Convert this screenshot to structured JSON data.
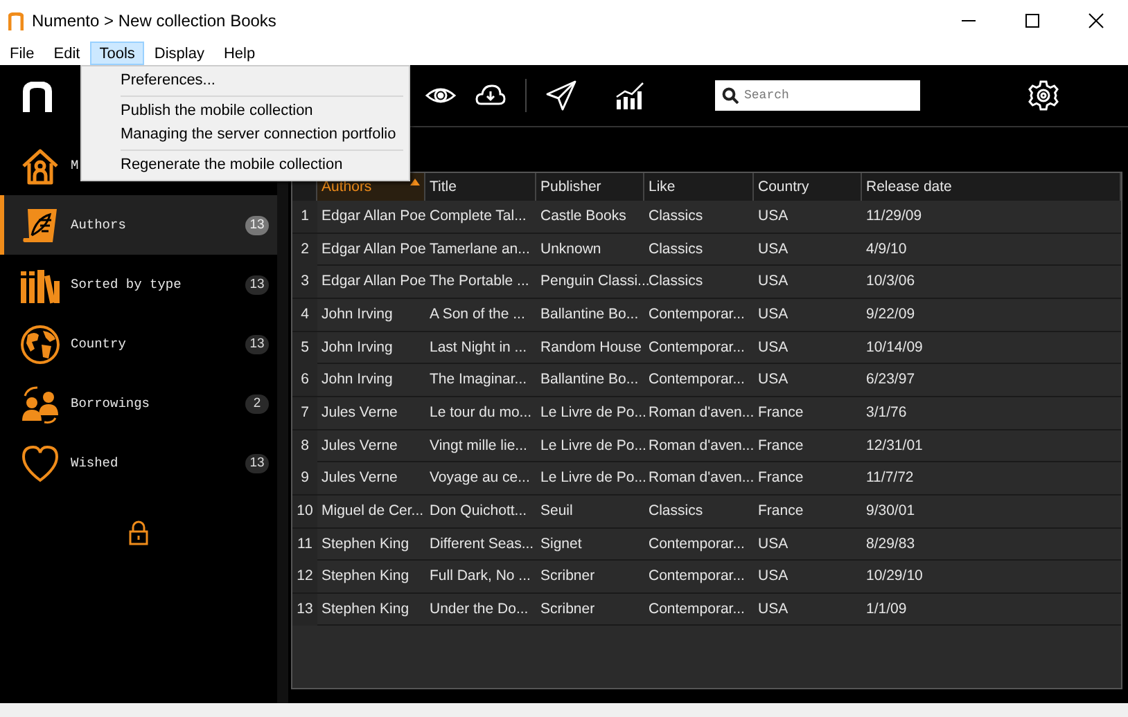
{
  "window": {
    "title": "Numento > New collection Books"
  },
  "menubar": [
    {
      "label": "File",
      "selected": false
    },
    {
      "label": "Edit",
      "selected": false
    },
    {
      "label": "Tools",
      "selected": true
    },
    {
      "label": "Display",
      "selected": false
    },
    {
      "label": "Help",
      "selected": false
    }
  ],
  "tools_menu": {
    "groups": [
      [
        "Preferences..."
      ],
      [
        "Publish the mobile collection",
        "Managing the server connection portfolio"
      ],
      [
        "Regenerate the mobile collection"
      ]
    ]
  },
  "search": {
    "placeholder": "Search"
  },
  "sidebar": {
    "items": [
      {
        "kind": "home",
        "label": "M",
        "selected": false
      },
      {
        "kind": "scroll",
        "label": "Authors",
        "count": "13",
        "selected": true
      },
      {
        "kind": "shelf",
        "label": "Sorted by type",
        "count": "13",
        "selected": false
      },
      {
        "kind": "globe",
        "label": "Country",
        "count": "13",
        "selected": false
      },
      {
        "kind": "people",
        "label": "Borrowings",
        "count": "2",
        "selected": false
      },
      {
        "kind": "heart",
        "label": "Wished",
        "count": "13",
        "selected": false
      }
    ]
  },
  "table": {
    "columns": [
      {
        "label": "Authors",
        "sorted": true
      },
      {
        "label": "Title",
        "sorted": false
      },
      {
        "label": "Publisher",
        "sorted": false
      },
      {
        "label": "Like",
        "sorted": false
      },
      {
        "label": "Country",
        "sorted": false
      },
      {
        "label": "Release date",
        "sorted": false
      }
    ],
    "rows": [
      {
        "number": "1",
        "cells": [
          "Edgar Allan Poe",
          "Complete Tal...",
          "Castle Books",
          "Classics",
          "USA",
          "11/29/09"
        ]
      },
      {
        "number": "2",
        "cells": [
          "Edgar Allan Poe",
          "Tamerlane an...",
          "Unknown",
          "Classics",
          "USA",
          "4/9/10"
        ]
      },
      {
        "number": "3",
        "cells": [
          "Edgar Allan Poe",
          "The Portable ...",
          "Penguin Classi...",
          "Classics",
          "USA",
          "10/3/06"
        ]
      },
      {
        "number": "4",
        "cells": [
          "John Irving",
          "A Son of the ...",
          "Ballantine Bo...",
          "Contemporar...",
          "USA",
          "9/22/09"
        ]
      },
      {
        "number": "5",
        "cells": [
          "John Irving",
          "Last Night in ...",
          "Random House",
          "Contemporar...",
          "USA",
          "10/14/09"
        ]
      },
      {
        "number": "6",
        "cells": [
          "John Irving",
          "The Imaginar...",
          "Ballantine Bo...",
          "Contemporar...",
          "USA",
          "6/23/97"
        ]
      },
      {
        "number": "7",
        "cells": [
          "Jules Verne",
          "Le tour du mo...",
          "Le Livre de Po...",
          "Roman d'aven...",
          "France",
          "3/1/76"
        ]
      },
      {
        "number": "8",
        "cells": [
          "Jules Verne",
          "Vingt mille lie...",
          "Le Livre de Po...",
          "Roman d'aven...",
          "France",
          "12/31/01"
        ]
      },
      {
        "number": "9",
        "cells": [
          "Jules Verne",
          "Voyage au ce...",
          "Le Livre de Po...",
          "Roman d'aven...",
          "France",
          "11/7/72"
        ]
      },
      {
        "number": "10",
        "cells": [
          "Miguel de Cer...",
          "Don Quichott...",
          "Seuil",
          "Classics",
          "France",
          "9/30/01"
        ]
      },
      {
        "number": "11",
        "cells": [
          "Stephen King",
          "Different Seas...",
          "Signet",
          "Contemporar...",
          "USA",
          "8/29/83"
        ]
      },
      {
        "number": "12",
        "cells": [
          "Stephen King",
          "Full Dark, No ...",
          "Scribner",
          "Contemporar...",
          "USA",
          "10/29/10"
        ]
      },
      {
        "number": "13",
        "cells": [
          "Stephen King",
          "Under the Do...",
          "Scribner",
          "Contemporar...",
          "USA",
          "1/1/09"
        ]
      }
    ]
  }
}
